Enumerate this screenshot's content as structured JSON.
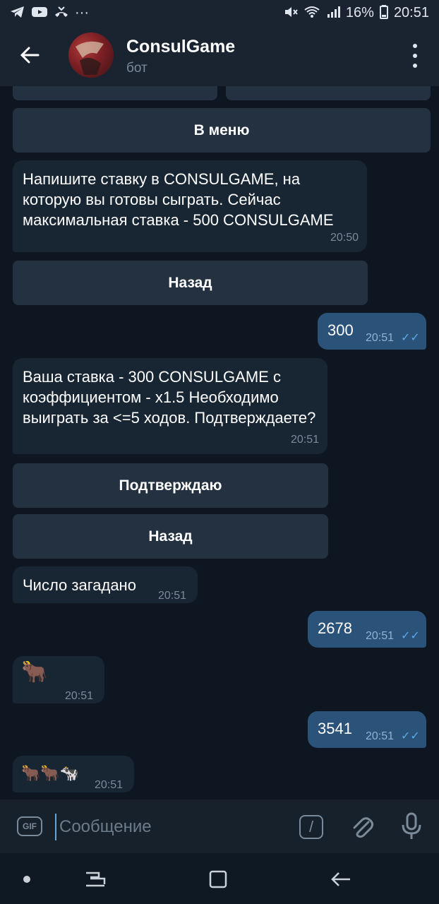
{
  "status_bar": {
    "battery": "16%",
    "time": "20:51",
    "dots": "···"
  },
  "header": {
    "title": "ConsulGame",
    "subtitle": "бот"
  },
  "keyboard_top": {
    "menu_label": "В меню"
  },
  "messages": [
    {
      "type": "in",
      "text": "Напишите ставку в CONSULGAME, на которую вы готовы сыграть. Сейчас максимальная ставка - 500 CONSULGAME",
      "time": "20:50"
    },
    {
      "type": "button",
      "label": "Назад"
    },
    {
      "type": "out",
      "text": "300",
      "time": "20:51"
    },
    {
      "type": "in",
      "text": "Ваша ставка - 300 CONSULGAME с коэффициентом - x1.5 Необходимо выиграть за <=5 ходов. Подтверждаете?",
      "time": "20:51"
    },
    {
      "type": "button",
      "label": "Подтверждаю"
    },
    {
      "type": "button",
      "label": "Назад"
    },
    {
      "type": "in",
      "text": "Число загадано",
      "time": "20:51"
    },
    {
      "type": "out",
      "text": "2678",
      "time": "20:51"
    },
    {
      "type": "in",
      "emoji": "🐂",
      "time": "20:51"
    },
    {
      "type": "out",
      "text": "3541",
      "time": "20:51"
    },
    {
      "type": "in",
      "emoji": "🐂🐂🐄",
      "time": "20:51"
    }
  ],
  "input": {
    "placeholder": "Сообщение",
    "gif_label": "GIF",
    "command_symbol": "/"
  },
  "colors": {
    "background": "#0e1621",
    "bubble_in": "#182533",
    "bubble_out": "#2b5278",
    "header": "#1a2431",
    "accent": "#5ea8e6"
  }
}
